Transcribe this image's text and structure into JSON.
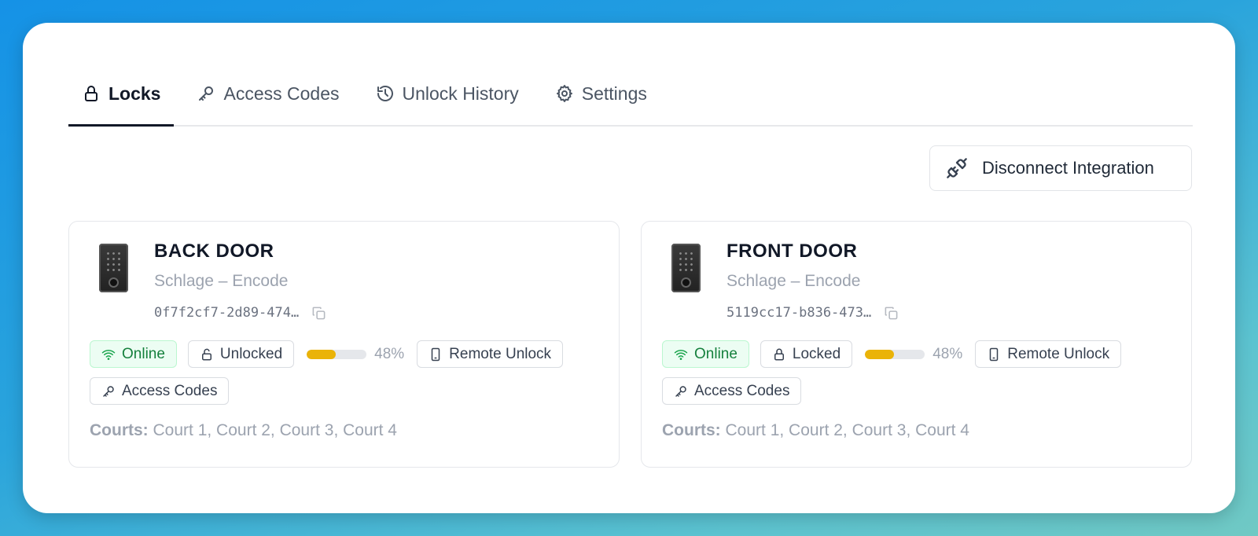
{
  "tabs": [
    {
      "label": "Locks",
      "icon": "lock-icon",
      "active": true
    },
    {
      "label": "Access Codes",
      "icon": "key-icon",
      "active": false
    },
    {
      "label": "Unlock History",
      "icon": "history-icon",
      "active": false
    },
    {
      "label": "Settings",
      "icon": "gear-icon",
      "active": false
    }
  ],
  "disconnect_label": "Disconnect Integration",
  "locks": [
    {
      "name": "BACK DOOR",
      "model": "Schlage – Encode",
      "device_id": "0f7f2cf7-2d89-474…",
      "connectivity": "Online",
      "lock_state": "Unlocked",
      "battery_fraction": 0.48,
      "battery_label": "48%",
      "remote_unlock_label": "Remote Unlock",
      "access_codes_label": "Access Codes",
      "courts_label": "Courts:",
      "courts_value": "Court 1, Court 2, Court 3, Court 4"
    },
    {
      "name": "FRONT DOOR",
      "model": "Schlage – Encode",
      "device_id": "5119cc17-b836-473…",
      "connectivity": "Online",
      "lock_state": "Locked",
      "battery_fraction": 0.48,
      "battery_label": "48%",
      "remote_unlock_label": "Remote Unlock",
      "access_codes_label": "Access Codes",
      "courts_label": "Courts:",
      "courts_value": "Court 1, Court 2, Court 3, Court 4"
    }
  ],
  "colors": {
    "online_green": "#15803d",
    "battery_yellow": "#eab308",
    "active_tab": "#111827"
  }
}
